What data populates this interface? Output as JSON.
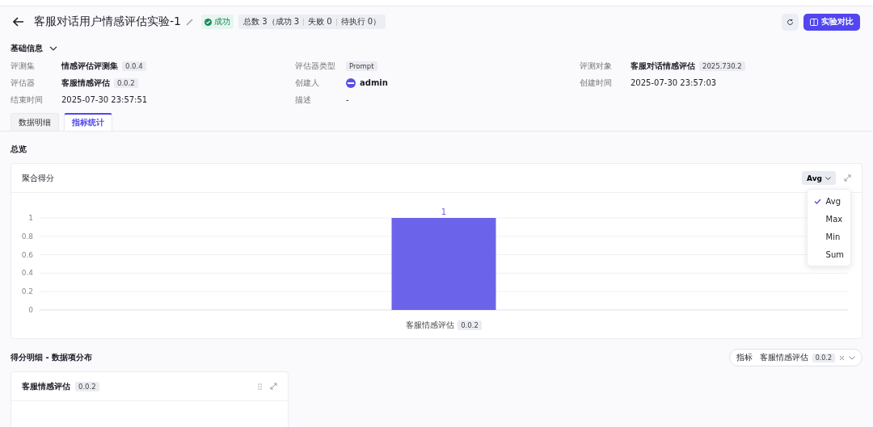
{
  "header": {
    "title": "客服对话用户情感评估实验-1",
    "status": "成功",
    "summary": [
      "总数 3（成功 3",
      "失败 0",
      "待执行 0）"
    ],
    "compare_button": "实验对比"
  },
  "basic_info": {
    "title": "基础信息",
    "expanded": true,
    "fields": [
      {
        "label": "评测集",
        "value": "情感评估评测集",
        "tag": "0.0.4",
        "kind": "bold"
      },
      {
        "label": "评估器类型",
        "tag": "Prompt",
        "kind": "tag"
      },
      {
        "label": "评测对象",
        "value": "客服对话情感评估",
        "tag": "2025.730.2",
        "kind": "bold"
      },
      {
        "label": "评估器",
        "value": "客服情感评估",
        "tag": "0.0.2",
        "kind": "bold"
      },
      {
        "label": "创建人",
        "value": "admin",
        "kind": "user"
      },
      {
        "label": "创建时间",
        "value": "2025-07-30 23:57:03",
        "kind": "text"
      },
      {
        "label": "结束时间",
        "value": "2025-07-30 23:57:51",
        "kind": "text"
      },
      {
        "label": "描述",
        "value": "-",
        "kind": "text"
      }
    ]
  },
  "tabs": [
    {
      "label": "数据明细",
      "selected": false
    },
    {
      "label": "指标统计",
      "selected": true
    }
  ],
  "overview": {
    "title": "总览",
    "card_title": "聚合得分",
    "aggregate": "Avg",
    "menu": [
      {
        "label": "Avg",
        "selected": true
      },
      {
        "label": "Max",
        "selected": false
      },
      {
        "label": "Min",
        "selected": false
      },
      {
        "label": "Sum",
        "selected": false
      }
    ],
    "category_tag": "0.0.2",
    "chart_data": {
      "type": "bar",
      "categories": [
        "客服情感评估"
      ],
      "values": [
        1
      ],
      "ylim": [
        0,
        1
      ],
      "yticks": [
        0,
        0.2,
        0.4,
        0.6,
        0.8,
        1
      ],
      "data_labels": true,
      "grid": true
    }
  },
  "distribution": {
    "title": "得分明细 - 数据项分布",
    "filter_label": "指标",
    "filter_value": "客服情感评估",
    "filter_tag": "0.0.2",
    "card_title": "客服情感评估",
    "card_tag": "0.0.2"
  }
}
